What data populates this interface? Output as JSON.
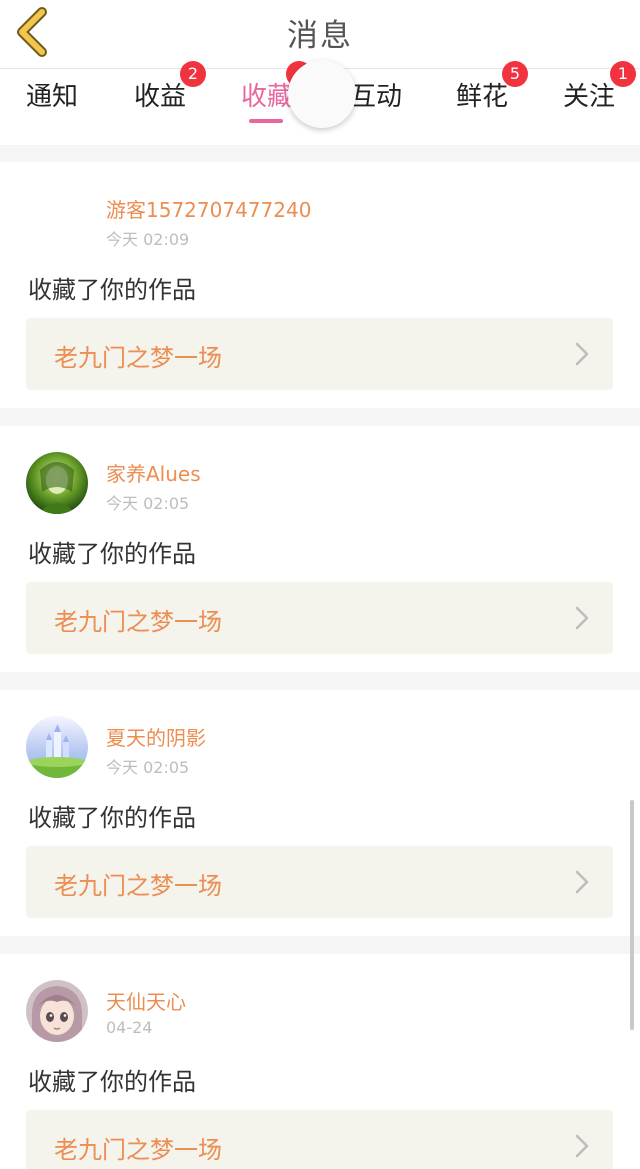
{
  "header": {
    "title": "消息"
  },
  "tabs": [
    {
      "label": "通知",
      "badge": ""
    },
    {
      "label": "收益",
      "badge": "2"
    },
    {
      "label": "收藏",
      "badge": ""
    },
    {
      "label": "互动",
      "badge": ""
    },
    {
      "label": "鲜花",
      "badge": "5"
    },
    {
      "label": "关注",
      "badge": "1"
    }
  ],
  "active_tab": "收藏",
  "colors": {
    "accent": "#e8679e",
    "name": "#ec8d52",
    "badge": "#f0333f",
    "back_icon": "#f3c64c"
  },
  "notifications": [
    {
      "user": "游客1572707477240",
      "time": "今天 02:09",
      "action": "收藏了你的作品",
      "work": "老九门之梦一场",
      "avatar": "none"
    },
    {
      "user": "家养Alues",
      "time": "今天 02:05",
      "action": "收藏了你的作品",
      "work": "老九门之梦一场",
      "avatar": "green-portrait"
    },
    {
      "user": "夏天的阴影",
      "time": "今天 02:05",
      "action": "收藏了你的作品",
      "work": "老九门之梦一场",
      "avatar": "castle-moon"
    },
    {
      "user": "天仙天心",
      "time": "04-24",
      "action": "收藏了你的作品",
      "work": "老九门之梦一场",
      "avatar": "anime-girl"
    }
  ]
}
